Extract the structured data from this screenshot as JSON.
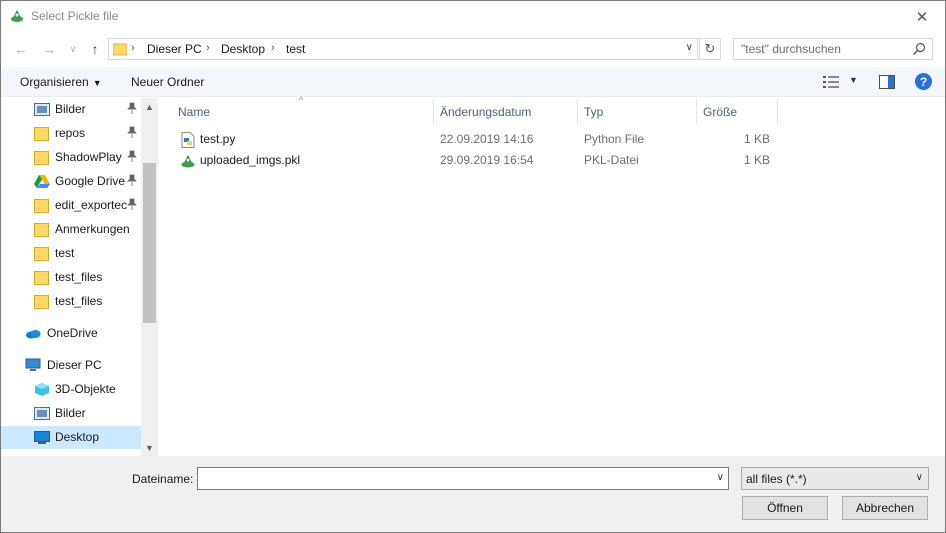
{
  "window": {
    "title": "Select Pickle file",
    "icons": {
      "app": "pickle-icon",
      "close": "close-icon"
    }
  },
  "address_bar": {
    "breadcrumbs": [
      "Dieser PC",
      "Desktop",
      "test"
    ],
    "search_placeholder": "\"test\" durchsuchen",
    "icons": {
      "back": "back-arrow-icon",
      "forward": "forward-arrow-icon",
      "recent": "chevron-down-icon",
      "up": "up-arrow-icon",
      "refresh": "refresh-icon",
      "search": "search-icon"
    }
  },
  "toolbar": {
    "organize_label": "Organisieren",
    "new_folder_label": "Neuer Ordner",
    "icons": {
      "view": "details-view-icon",
      "preview": "preview-pane-icon",
      "help": "help-icon"
    }
  },
  "sidebar": {
    "items": [
      {
        "label": "Bilder",
        "icon": "pictures-icon",
        "pinned": true
      },
      {
        "label": "repos",
        "icon": "folder-icon",
        "pinned": true
      },
      {
        "label": "ShadowPlay",
        "icon": "folder-icon",
        "pinned": true
      },
      {
        "label": "Google Drive",
        "icon": "google-drive-icon",
        "pinned": true
      },
      {
        "label": "edit_exportec",
        "icon": "folder-icon",
        "pinned": true
      },
      {
        "label": "Anmerkungen",
        "icon": "folder-icon",
        "pinned": false
      },
      {
        "label": "test",
        "icon": "folder-icon",
        "pinned": false
      },
      {
        "label": "test_files",
        "icon": "folder-icon",
        "pinned": false
      },
      {
        "label": "test_files",
        "icon": "folder-icon",
        "pinned": false
      },
      {
        "label": "OneDrive",
        "icon": "onedrive-icon",
        "pinned": false
      },
      {
        "label": "Dieser PC",
        "icon": "computer-icon",
        "pinned": false
      },
      {
        "label": "3D-Objekte",
        "icon": "3d-objects-icon",
        "pinned": false
      },
      {
        "label": "Bilder",
        "icon": "pictures-icon",
        "pinned": false
      },
      {
        "label": "Desktop",
        "icon": "desktop-icon",
        "pinned": false,
        "selected": true
      }
    ]
  },
  "file_list": {
    "columns": [
      "Name",
      "Änderungsdatum",
      "Typ",
      "Größe"
    ],
    "rows": [
      {
        "name": "test.py",
        "date": "22.09.2019 14:16",
        "type": "Python File",
        "size": "1 KB",
        "icon": "python-file-icon"
      },
      {
        "name": "uploaded_imgs.pkl",
        "date": "29.09.2019 16:54",
        "type": "PKL-Datei",
        "size": "1 KB",
        "icon": "pickle-file-icon"
      }
    ]
  },
  "footer": {
    "filename_label": "Dateiname:",
    "filename_value": "",
    "filter_value": "all files (*.*)",
    "open_label": "Öffnen",
    "cancel_label": "Abbrechen"
  },
  "colors": {
    "selection": "#cce8ff",
    "toolbar_bg": "#f3f7fc",
    "footer_bg": "#f0f0f0",
    "help_blue": "#2a6fd6",
    "folder_yellow": "#ffd766"
  }
}
